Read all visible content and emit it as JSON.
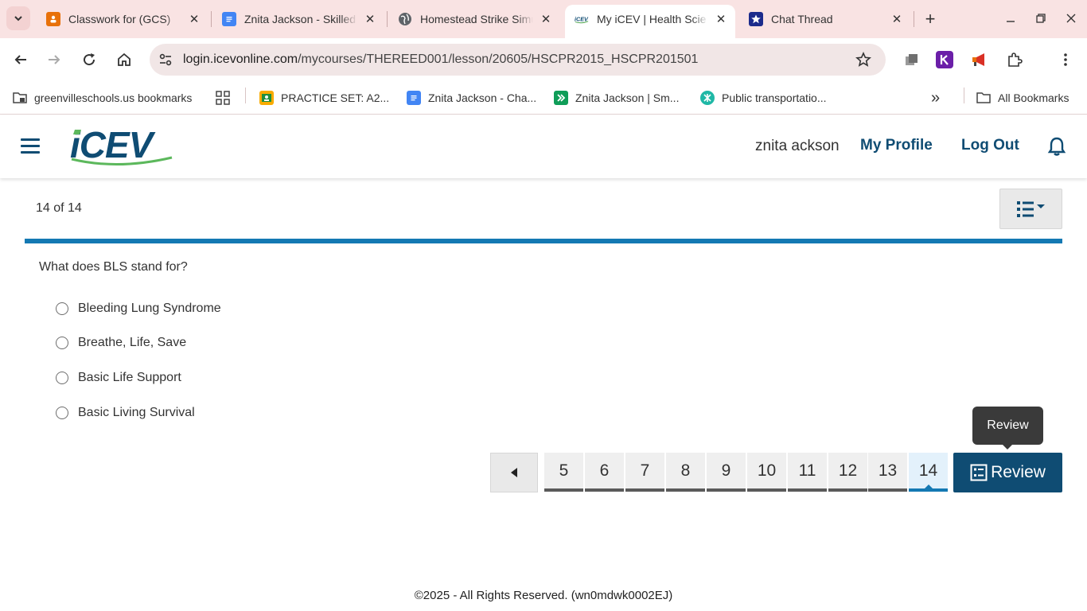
{
  "browser": {
    "tabs": [
      {
        "title": "Classwork for (GCS) ",
        "favicon": "google-classroom-icon",
        "active": false
      },
      {
        "title": "Znita Jackson - Skilled",
        "favicon": "google-docs-icon",
        "active": false
      },
      {
        "title": "Homestead Strike Simul",
        "favicon": "globe-icon",
        "active": false
      },
      {
        "title": "My iCEV | Health Scie",
        "favicon": "icev-icon",
        "active": true
      },
      {
        "title": "Chat Thread",
        "favicon": "star-badge-icon",
        "active": false
      }
    ],
    "tab_close_glyph": "✕",
    "new_tab_glyph": "+",
    "url_host": "login.icevonline.com",
    "url_path": "/mycourses/THEREED001/lesson/20605/HSCPR2015_HSCPR201501",
    "bookmarks": [
      {
        "label": "greenvilleschools.us bookmarks",
        "icon": "managed-folder-icon"
      },
      {
        "label": "PRACTICE SET: A2...",
        "icon": "google-classroom-icon"
      },
      {
        "label": "Znita Jackson - Cha...",
        "icon": "google-docs-icon"
      },
      {
        "label": "Znita Jackson | Sm...",
        "icon": "smartsheet-icon"
      },
      {
        "label": "Public transportatio...",
        "icon": "perplexity-icon"
      }
    ],
    "all_bookmarks": "All Bookmarks",
    "overflow_glyph": "»",
    "colors": {
      "tabbar": "#f9e3e3",
      "omnibox": "#f1e6e6"
    }
  },
  "header": {
    "logo_text": "iCEV",
    "user_name": "znita ackson",
    "my_profile": "My Profile",
    "log_out": "Log Out",
    "brand_color": "#0f4c73",
    "accent_color": "#1479b3"
  },
  "lesson": {
    "progress_text": "14 of 14",
    "question": "What does BLS stand for?",
    "options": [
      "Bleeding Lung Syndrome",
      "Breathe, Life, Save",
      "Basic Life Support",
      "Basic Living Survival"
    ]
  },
  "pagination": {
    "pages": [
      "5",
      "6",
      "7",
      "8",
      "9",
      "10",
      "11",
      "12",
      "13",
      "14"
    ],
    "current_page": "14",
    "review_label": "Review",
    "tooltip": "Review"
  },
  "footer": {
    "text": "©2025 - All Rights Reserved. (wn0mdwk0002EJ)"
  }
}
